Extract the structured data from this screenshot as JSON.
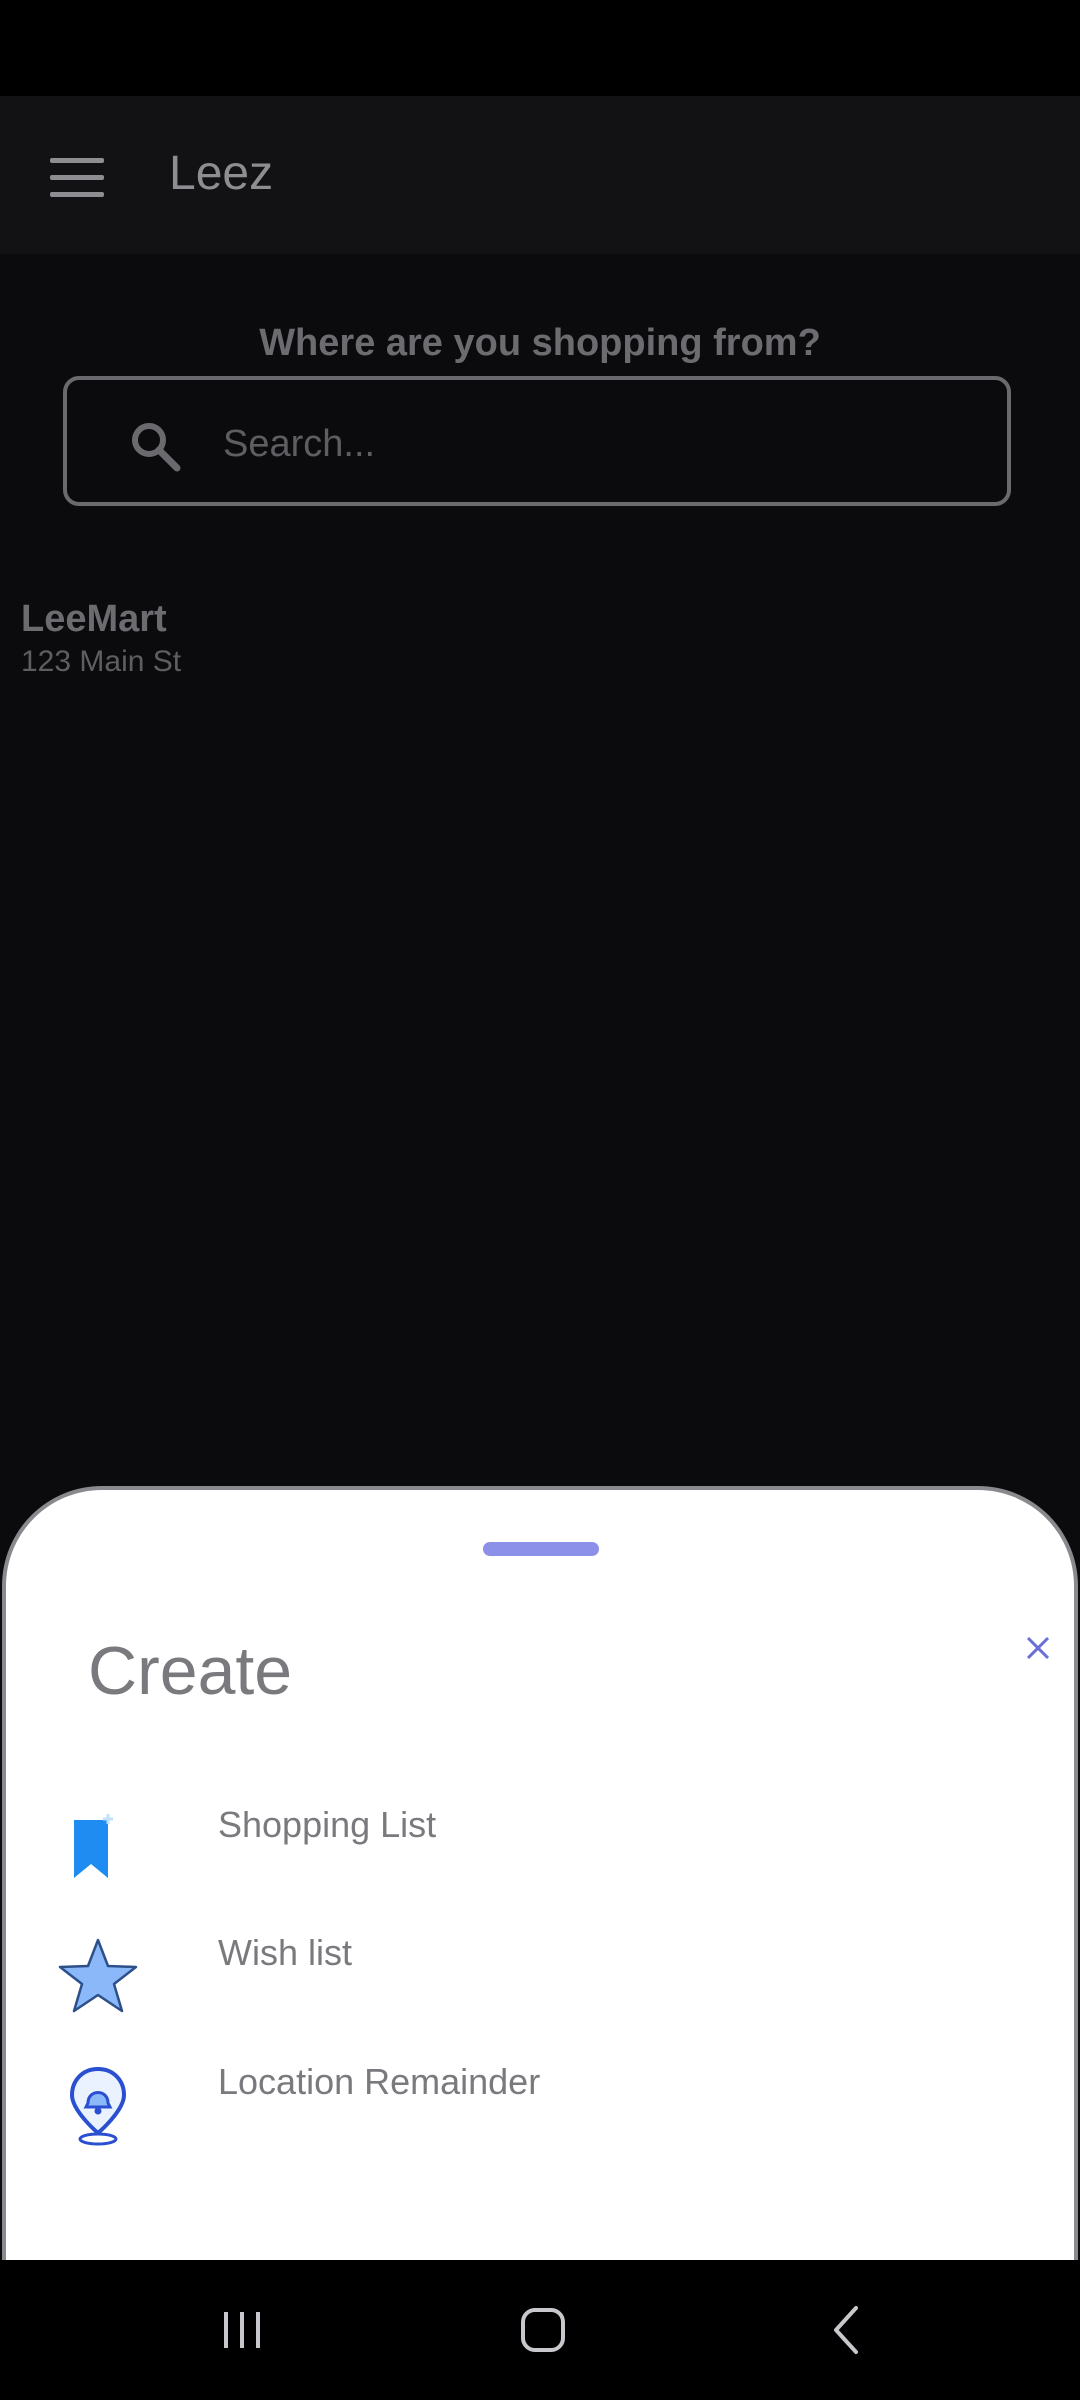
{
  "app": {
    "title": "Leez"
  },
  "main": {
    "question": "Where are you shopping from?",
    "search": {
      "placeholder": "Search..."
    },
    "stores": [
      {
        "name": "LeeMart",
        "address": "123 Main St"
      }
    ]
  },
  "sheet": {
    "title": "Create",
    "options": [
      {
        "label": "Shopping List",
        "icon": "bookmark-icon"
      },
      {
        "label": "Wish list",
        "icon": "star-icon"
      },
      {
        "label": "Location Remainder",
        "icon": "location-bell-icon"
      }
    ]
  },
  "colors": {
    "background": "#0b0b0d",
    "sheet_background": "#ffffff",
    "accent": "#8d90e8",
    "icon_blue": "#1e6ff0"
  }
}
